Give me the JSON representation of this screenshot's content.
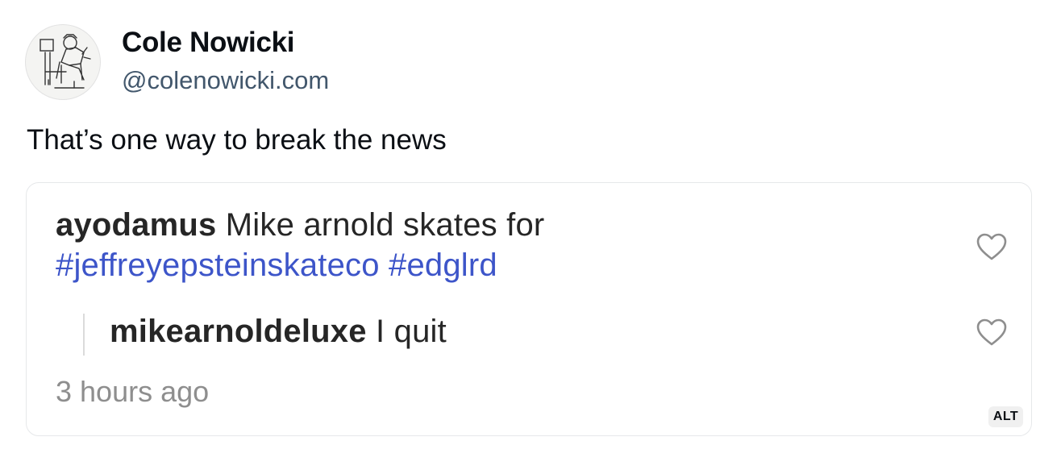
{
  "author": {
    "display_name": "Cole Nowicki",
    "handle": "@colenowicki.com",
    "avatar_icon": "person-sitting-sketch-avatar"
  },
  "post": {
    "text": "That’s one way to break the news"
  },
  "embed_image": {
    "comment": {
      "username": "ayodamus",
      "text_line1": " Mike arnold skates for",
      "hashtag1": "#jeffreyepsteinskateco",
      "hashtag2": "#edglrd"
    },
    "reply": {
      "username": "mikearnoldeluxe",
      "text": " I quit"
    },
    "timestamp": "3 hours ago",
    "like_icon": "heart-outline-icon",
    "alt_label": "ALT"
  },
  "colors": {
    "text_primary": "#0b0f14",
    "handle": "#42576c",
    "hashtag": "#3d55c9",
    "timestamp": "#8e8e8e"
  }
}
